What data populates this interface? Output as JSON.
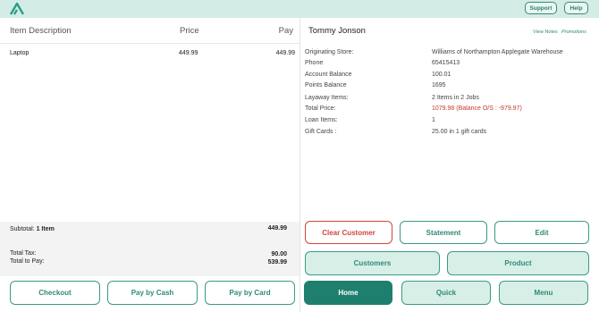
{
  "header": {
    "support_label": "Support",
    "help_label": "Help"
  },
  "cart": {
    "columns": {
      "description": "Item Description",
      "price": "Price",
      "pay": "Pay"
    },
    "items": [
      {
        "description": "Laptop",
        "price": "449.99",
        "pay": "449.99"
      }
    ]
  },
  "totals": {
    "subtotal_label": "Subtotal:",
    "subtotal_count": "1 Item",
    "subtotal_value": "449.99",
    "tax_label": "Total Tax:",
    "tax_value": "90.00",
    "topay_label": "Total to Pay:",
    "topay_value": "539.99"
  },
  "customer": {
    "name": "Tommy Jonson",
    "view_notes": "View Notes",
    "promotions": "Promotions",
    "fields": [
      {
        "label": "Originating Store:",
        "value": "Williams of Northampton Applegate Warehouse"
      },
      {
        "label": "Phone",
        "value": "65415413"
      },
      {
        "label": "Account Balance",
        "value": "100.01"
      },
      {
        "label": "Points Balance",
        "value": "1695"
      },
      {
        "label": "Layaway Items:",
        "value": "2 Items in 2 Jobs"
      },
      {
        "label": "Total Price:",
        "value": "1079.98 (Balance O/S : -979.97)"
      },
      {
        "label": "Loan Items:",
        "value": "1"
      },
      {
        "label": "Gift Cards :",
        "value": "25.00 in 1 gift cards"
      }
    ]
  },
  "actions": {
    "clear_customer": "Clear Customer",
    "statement": "Statement",
    "edit": "Edit",
    "customers": "Customers",
    "product": "Product",
    "checkout": "Checkout",
    "pay_cash": "Pay by Cash",
    "pay_card": "Pay by Card",
    "home": "Home",
    "quick": "Quick",
    "menu": "Menu"
  },
  "colors": {
    "accent": "#2f8a76",
    "header_bg": "#d4ece6",
    "warning": "#c0392b",
    "danger_border": "#d0463a"
  }
}
